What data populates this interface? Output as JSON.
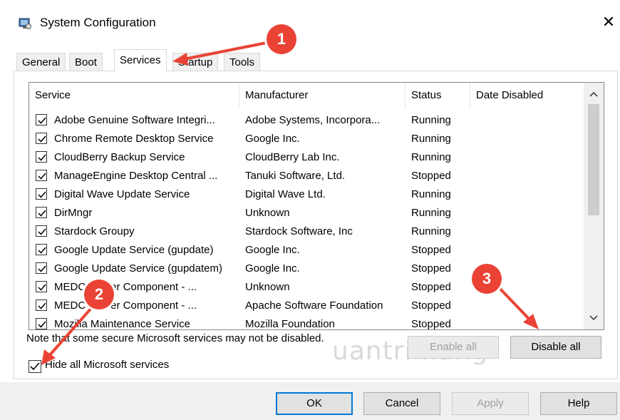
{
  "window": {
    "title": "System Configuration",
    "close_symbol": "✕"
  },
  "tabs": [
    "General",
    "Boot",
    "Services",
    "Startup",
    "Tools"
  ],
  "active_tab": "Services",
  "columns": [
    "Service",
    "Manufacturer",
    "Status",
    "Date Disabled"
  ],
  "services": [
    {
      "service": "Adobe Genuine Software Integri...",
      "manufacturer": "Adobe Systems, Incorpora...",
      "status": "Running",
      "date_disabled": "",
      "checked": true
    },
    {
      "service": "Chrome Remote Desktop Service",
      "manufacturer": "Google Inc.",
      "status": "Running",
      "date_disabled": "",
      "checked": true
    },
    {
      "service": "CloudBerry Backup Service",
      "manufacturer": "CloudBerry Lab Inc.",
      "status": "Running",
      "date_disabled": "",
      "checked": true
    },
    {
      "service": "ManageEngine Desktop Central ...",
      "manufacturer": "Tanuki Software, Ltd.",
      "status": "Stopped",
      "date_disabled": "",
      "checked": true
    },
    {
      "service": "Digital Wave Update Service",
      "manufacturer": "Digital Wave Ltd.",
      "status": "Running",
      "date_disabled": "",
      "checked": true
    },
    {
      "service": "DirMngr",
      "manufacturer": "Unknown",
      "status": "Running",
      "date_disabled": "",
      "checked": true
    },
    {
      "service": "Stardock Groupy",
      "manufacturer": "Stardock Software, Inc",
      "status": "Running",
      "date_disabled": "",
      "checked": true
    },
    {
      "service": "Google Update Service (gupdate)",
      "manufacturer": "Google Inc.",
      "status": "Stopped",
      "date_disabled": "",
      "checked": true
    },
    {
      "service": "Google Update Service (gupdatem)",
      "manufacturer": "Google Inc.",
      "status": "Stopped",
      "date_disabled": "",
      "checked": true
    },
    {
      "service": "MEDC Server Component - ...",
      "manufacturer": "Unknown",
      "status": "Stopped",
      "date_disabled": "",
      "checked": true
    },
    {
      "service": "MEDC Server Component - ...",
      "manufacturer": "Apache Software Foundation",
      "status": "Stopped",
      "date_disabled": "",
      "checked": true
    },
    {
      "service": "Mozilla Maintenance Service",
      "manufacturer": "Mozilla Foundation",
      "status": "Stopped",
      "date_disabled": "",
      "checked": true
    }
  ],
  "note": "Note that some secure Microsoft services may not be disabled.",
  "enable_all_label": "Enable all",
  "disable_all_label": "Disable all",
  "hide_ms_label": "Hide all Microsoft services",
  "hide_ms_checked": true,
  "footer_buttons": {
    "ok": "OK",
    "cancel": "Cancel",
    "apply": "Apply",
    "help": "Help"
  },
  "annotations": {
    "badge_1": "1",
    "badge_2": "2",
    "badge_3": "3"
  },
  "watermark": "uantrimang",
  "colors": {
    "annotation_red": "#ea4335",
    "accent_blue": "#0078d7",
    "scrollbar_thumb": "#cdcdcd"
  },
  "icons": {
    "app": "system-config-icon",
    "close": "close-icon",
    "scroll_up": "chevron-up-icon",
    "scroll_down": "chevron-down-icon",
    "check": "checkmark-icon"
  }
}
